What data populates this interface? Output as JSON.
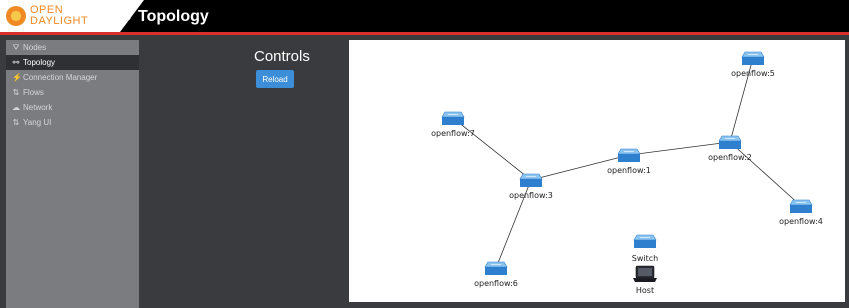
{
  "app": {
    "logo_line1": "OPEN",
    "logo_line2": "DAYLIGHT",
    "page_title": "Topology"
  },
  "sidebar": {
    "items": [
      {
        "label": "Nodes",
        "icon": "sitemap-icon",
        "glyph": "⛛",
        "active": false
      },
      {
        "label": "Topology",
        "icon": "topology-icon",
        "glyph": "⚯",
        "active": true
      },
      {
        "label": "Connection Manager",
        "icon": "plug-icon",
        "glyph": "⚡",
        "active": false
      },
      {
        "label": "Flows",
        "icon": "flows-icon",
        "glyph": "⇅",
        "active": false
      },
      {
        "label": "Network",
        "icon": "cloud-icon",
        "glyph": "☁",
        "active": false
      },
      {
        "label": "Yang UI",
        "icon": "yang-icon",
        "glyph": "⇅",
        "active": false
      }
    ]
  },
  "controls": {
    "title": "Controls",
    "reload_label": "Reload"
  },
  "topology": {
    "nodes": [
      {
        "id": "5",
        "label": "openflow:5"
      },
      {
        "id": "7",
        "label": "openflow:7"
      },
      {
        "id": "1",
        "label": "openflow:1"
      },
      {
        "id": "2",
        "label": "openflow:2"
      },
      {
        "id": "3",
        "label": "openflow:3"
      },
      {
        "id": "4",
        "label": "openflow:4"
      },
      {
        "id": "6",
        "label": "openflow:6"
      }
    ],
    "links": [
      [
        "5",
        "2"
      ],
      [
        "2",
        "1"
      ],
      [
        "2",
        "4"
      ],
      [
        "1",
        "3"
      ],
      [
        "7",
        "3"
      ],
      [
        "3",
        "6"
      ]
    ],
    "legend": {
      "switch_label": "Switch",
      "host_label": "Host"
    }
  },
  "colors": {
    "accent_red": "#d9302b",
    "switch_blue": "#2f7fcf",
    "button_blue": "#3c8ed8"
  }
}
